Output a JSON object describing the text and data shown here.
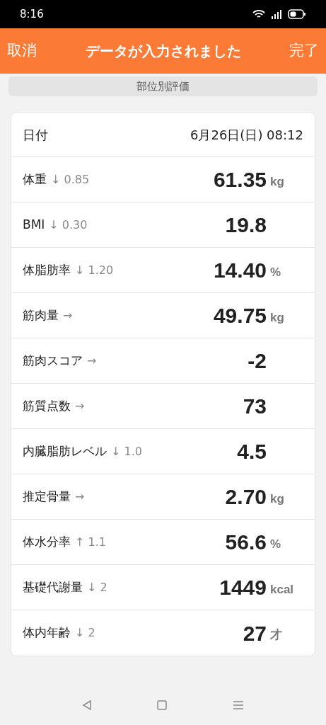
{
  "status_bar": {
    "time": "8:16"
  },
  "header": {
    "cancel": "取消",
    "title": "データが入力されました",
    "done": "完了"
  },
  "section_button": "部位別評価",
  "date_row": {
    "label": "日付",
    "value": "6月26日(日) 08:12"
  },
  "rows": [
    {
      "label": "体重",
      "trend": "↓ 0.85",
      "value": "61.35",
      "unit": "kg"
    },
    {
      "label": "BMI",
      "trend": "↓ 0.30",
      "value": "19.8"
    },
    {
      "label": "体脂肪率",
      "trend": "↓ 1.20",
      "value": "14.40",
      "unit": "%"
    },
    {
      "label": "筋肉量",
      "trend": "→",
      "value": "49.75",
      "unit": "kg"
    },
    {
      "label": "筋肉スコア",
      "trend": "→",
      "value": "-2"
    },
    {
      "label": "筋質点数",
      "trend": "→",
      "value": "73"
    },
    {
      "label": "内臓脂肪レベル",
      "trend": "↓ 1.0",
      "value": "4.5"
    },
    {
      "label": "推定骨量",
      "trend": "→",
      "value": "2.70",
      "unit": "kg"
    },
    {
      "label": "体水分率",
      "trend": "↑ 1.1",
      "value": "56.6",
      "unit": "%"
    },
    {
      "label": "基礎代謝量",
      "trend": "↓ 2",
      "value": "1449",
      "unit": "kcal"
    },
    {
      "label": "体内年齢",
      "trend": "↓ 2",
      "value": "27",
      "unit": "才"
    }
  ]
}
